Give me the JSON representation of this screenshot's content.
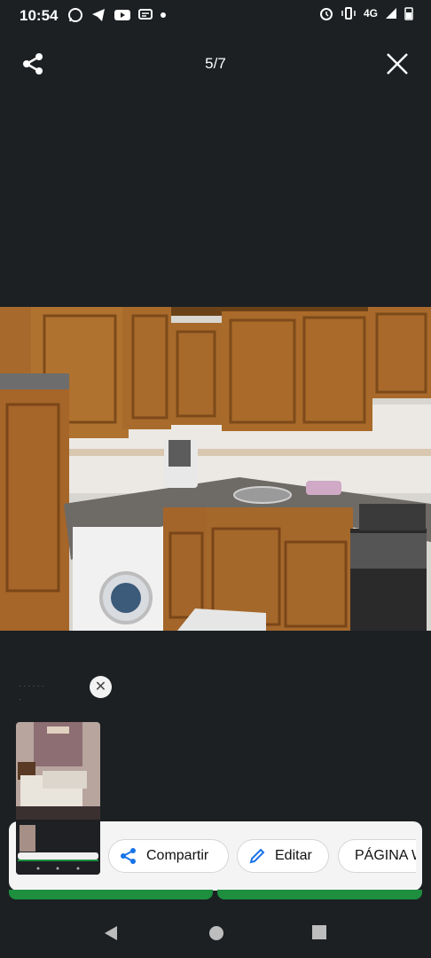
{
  "status": {
    "time": "10:54",
    "network": "4G"
  },
  "viewer": {
    "counter": "5/7"
  },
  "actions": {
    "share_label": "Compartir",
    "edit_label": "Editar",
    "page_label": "PÁGINA W"
  },
  "colors": {
    "accent_blue": "#1a73e8",
    "green": "#1d8f3f"
  }
}
